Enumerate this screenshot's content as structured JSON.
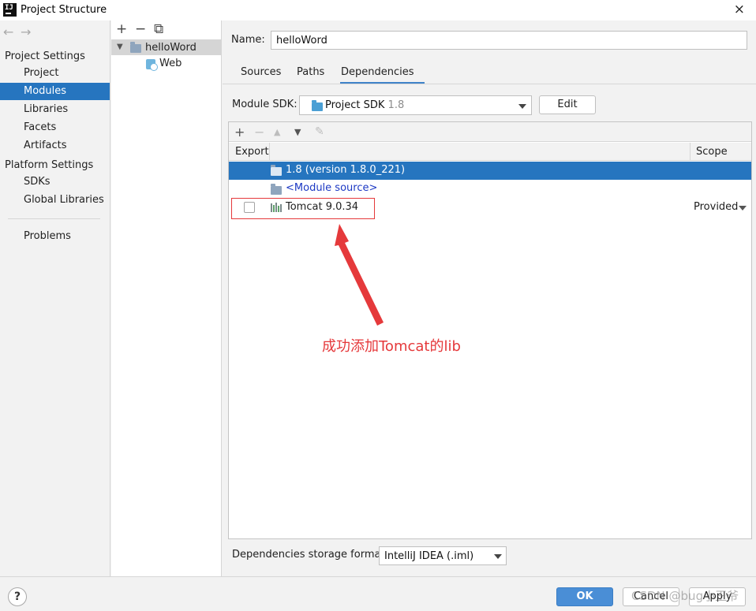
{
  "window": {
    "logo_text": "IJ",
    "title": "Project Structure",
    "close_icon": "×"
  },
  "nav": {
    "back_icon": "←",
    "forward_icon": "→",
    "project_settings_label": "Project Settings",
    "project_settings_items": [
      "Project",
      "Modules",
      "Libraries",
      "Facets",
      "Artifacts"
    ],
    "platform_settings_label": "Platform Settings",
    "platform_settings_items": [
      "SDKs",
      "Global Libraries"
    ],
    "problems_label": "Problems",
    "selected_item": "Modules"
  },
  "tree": {
    "toolbar": [
      "+",
      "−",
      "⧉"
    ],
    "module_name": "helloWord",
    "facet_name": "Web"
  },
  "module": {
    "name_label": "Name:",
    "name_value": "helloWord",
    "tabs": [
      "Sources",
      "Paths",
      "Dependencies"
    ],
    "active_tab": "Dependencies",
    "sdk_label": "Module SDK:",
    "sdk_value": "Project SDK",
    "sdk_version": "1.8",
    "edit_label": "Edit"
  },
  "dependencies": {
    "toolbar": [
      "+",
      "−",
      "▲",
      "▼",
      "✎"
    ],
    "columns": {
      "export": "Export",
      "scope": "Scope"
    },
    "rows": [
      {
        "name": "1.8 (version 1.8.0_221)",
        "selected": true
      },
      {
        "name": "<Module source>",
        "selected": false
      },
      {
        "name": "Tomcat 9.0.34",
        "scope": "Provided",
        "exported": false
      }
    ]
  },
  "annotation": {
    "text": "成功添加Tomcat的lib",
    "color": "#e5393b"
  },
  "storage": {
    "label": "Dependencies storage format:",
    "value": "IntelliJ IDEA (.iml)"
  },
  "footer": {
    "help": "?",
    "ok_label": "OK",
    "cancel_label": "Cancel",
    "apply_label": "Apply",
    "watermark": "CSDN @bug小王爷"
  },
  "colors": {
    "selection": "#2675bf",
    "primary_button": "#4a8ed6",
    "annotation_red": "#e5393b"
  }
}
